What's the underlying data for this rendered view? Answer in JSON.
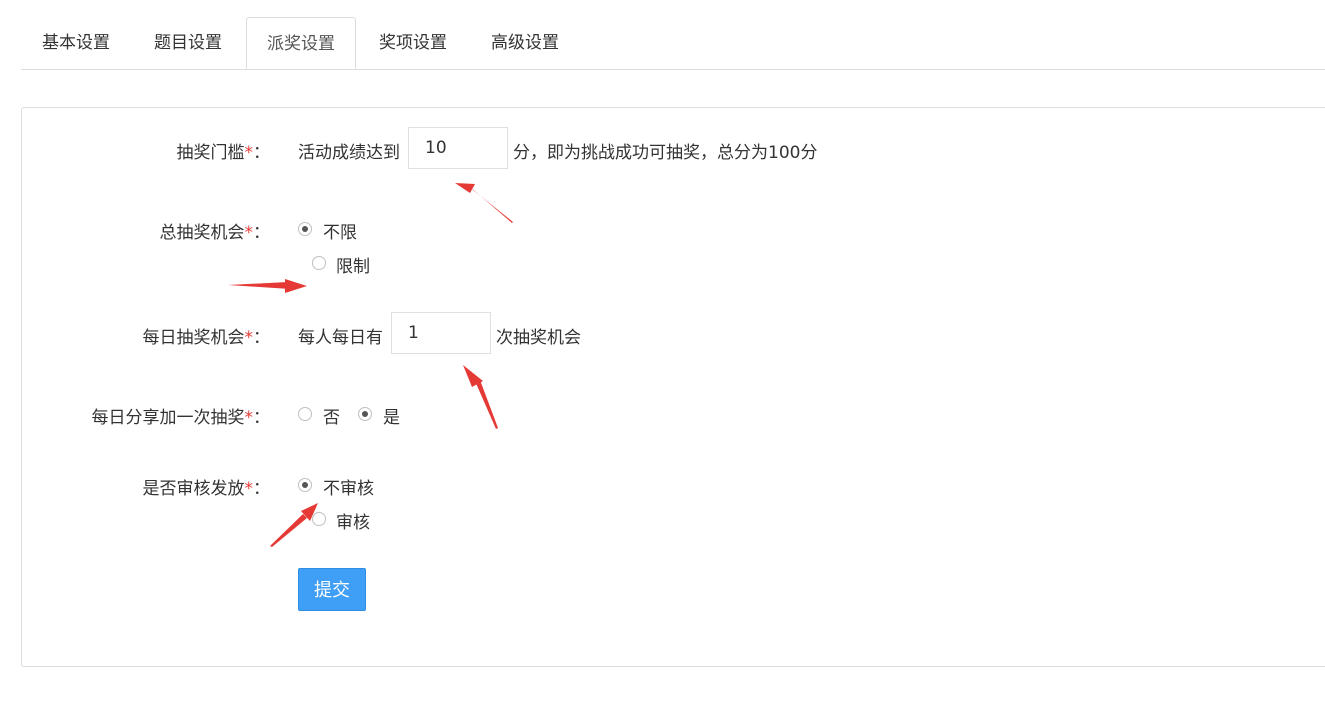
{
  "tabs": [
    {
      "label": "基本设置"
    },
    {
      "label": "题目设置"
    },
    {
      "label": "派奖设置",
      "active": true
    },
    {
      "label": "奖项设置"
    },
    {
      "label": "高级设置"
    }
  ],
  "form": {
    "required_mark": "*",
    "colon": "：",
    "threshold": {
      "label": "抽奖门槛",
      "prefix": "活动成绩达到",
      "value": "10",
      "suffix": "分，即为挑战成功可抽奖，总分为100分"
    },
    "total_chances": {
      "label": "总抽奖机会",
      "options": [
        "不限",
        "限制"
      ],
      "selected": "不限"
    },
    "daily_chances": {
      "label": "每日抽奖机会",
      "prefix": "每人每日有",
      "value": "1",
      "suffix": "次抽奖机会"
    },
    "share_bonus": {
      "label": "每日分享加一次抽奖",
      "options": [
        "否",
        "是"
      ],
      "selected": "是"
    },
    "review": {
      "label": "是否审核发放",
      "options": [
        "不审核",
        "审核"
      ],
      "selected": "不审核"
    },
    "submit_label": "提交"
  },
  "colors": {
    "accent": "#3f9ef5",
    "required": "#e53935",
    "annotation_arrow": "#e53935"
  }
}
